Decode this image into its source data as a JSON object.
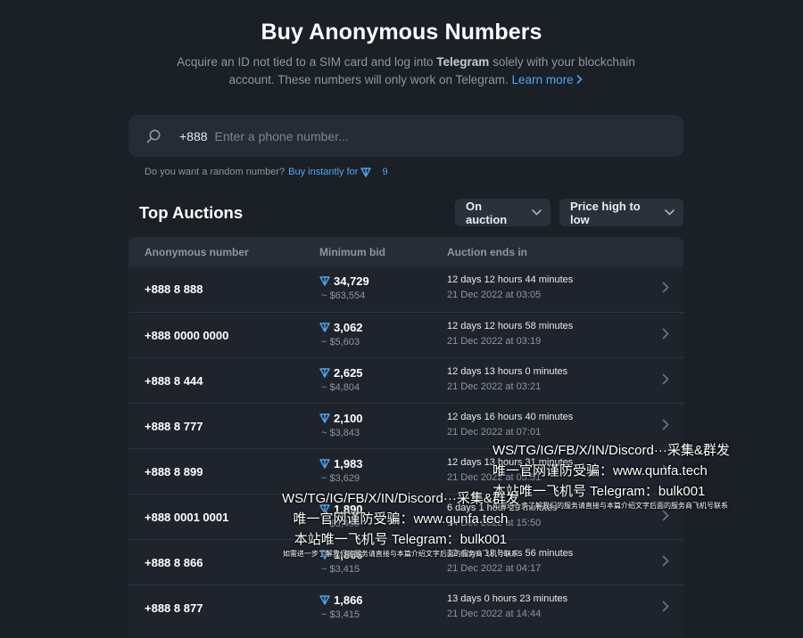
{
  "header": {
    "title": "Buy Anonymous Numbers",
    "subtitle_before": "Acquire an ID not tied to a SIM card and log into ",
    "subtitle_bold": "Telegram",
    "subtitle_after": " solely with your blockchain account. These numbers will only work on Telegram.",
    "learn_more": "Learn more"
  },
  "search": {
    "prefix": "+888",
    "placeholder": "Enter a phone number..."
  },
  "random": {
    "question": "Do you want a random number?",
    "buy_label": "Buy instantly for",
    "price": "9"
  },
  "section": {
    "title": "Top Auctions",
    "filter_status": "On auction",
    "filter_sort": "Price high to low"
  },
  "table": {
    "headers": {
      "number": "Anonymous number",
      "bid": "Minimum bid",
      "ends": "Auction ends in"
    },
    "rows": [
      {
        "number": "+888 8 888",
        "ton": "34,729",
        "usd": "~ $63,554",
        "rel": "12 days 12 hours 44 minutes",
        "abs": "21 Dec 2022 at 03:05"
      },
      {
        "number": "+888 0000 0000",
        "ton": "3,062",
        "usd": "~ $5,603",
        "rel": "12 days 12 hours 58 minutes",
        "abs": "21 Dec 2022 at 03:19"
      },
      {
        "number": "+888 8 444",
        "ton": "2,625",
        "usd": "~ $4,804",
        "rel": "12 days 13 hours 0 minutes",
        "abs": "21 Dec 2022 at 03:21"
      },
      {
        "number": "+888 8 777",
        "ton": "2,100",
        "usd": "~ $3,843",
        "rel": "12 days 16 hours 40 minutes",
        "abs": "21 Dec 2022 at 07:01"
      },
      {
        "number": "+888 8 899",
        "ton": "1,983",
        "usd": "~ $3,629",
        "rel": "12 days 13 hours 31 minutes",
        "abs": "21 Dec 2022 at 03:51"
      },
      {
        "number": "+888 0001 0001",
        "ton": "1,890",
        "usd": "~ $3,459",
        "rel": "6 days 1 hour 29 minutes",
        "abs": "14 Dec 2022 at 15:50"
      },
      {
        "number": "+888 8 866",
        "ton": "1,866",
        "usd": "~ $3,415",
        "rel": "12 days 13 hours 56 minutes",
        "abs": "21 Dec 2022 at 04:17"
      },
      {
        "number": "+888 8 877",
        "ton": "1,866",
        "usd": "~ $3,415",
        "rel": "13 days 0 hours 23 minutes",
        "abs": "21 Dec 2022 at 14:44"
      }
    ]
  },
  "watermarks": {
    "a_line1": "WS/TG/IG/FB/X/IN/Discord···采集&群发",
    "a_line2": "唯一官网谨防受骗：www.qunfa.tech",
    "a_line3": "本站唯一飞机号 Telegram：bulk001",
    "a_line4": "如需进一步了解我们的服务请直接与本篇介绍文字后面的服务商飞机号联系",
    "b_line1": "WS/TG/IG/FB/X/IN/Discord···采集&群发",
    "b_line2": "唯一官网谨防受骗：www.qunfa.tech",
    "b_line3": "本站唯一飞机号 Telegram：bulk001",
    "b_line4": "如需进一步了解我们的服务请直接与本篇介绍文字后面的服务商飞机号联系"
  },
  "icons": {
    "search": "search-icon",
    "ton": "ton-icon",
    "chevron": "chevron-down-icon",
    "arrow": "chevron-right-icon"
  },
  "colors": {
    "background": "#1b1f26",
    "accent": "#4fa6f0",
    "ton": "#4fa6f0"
  }
}
